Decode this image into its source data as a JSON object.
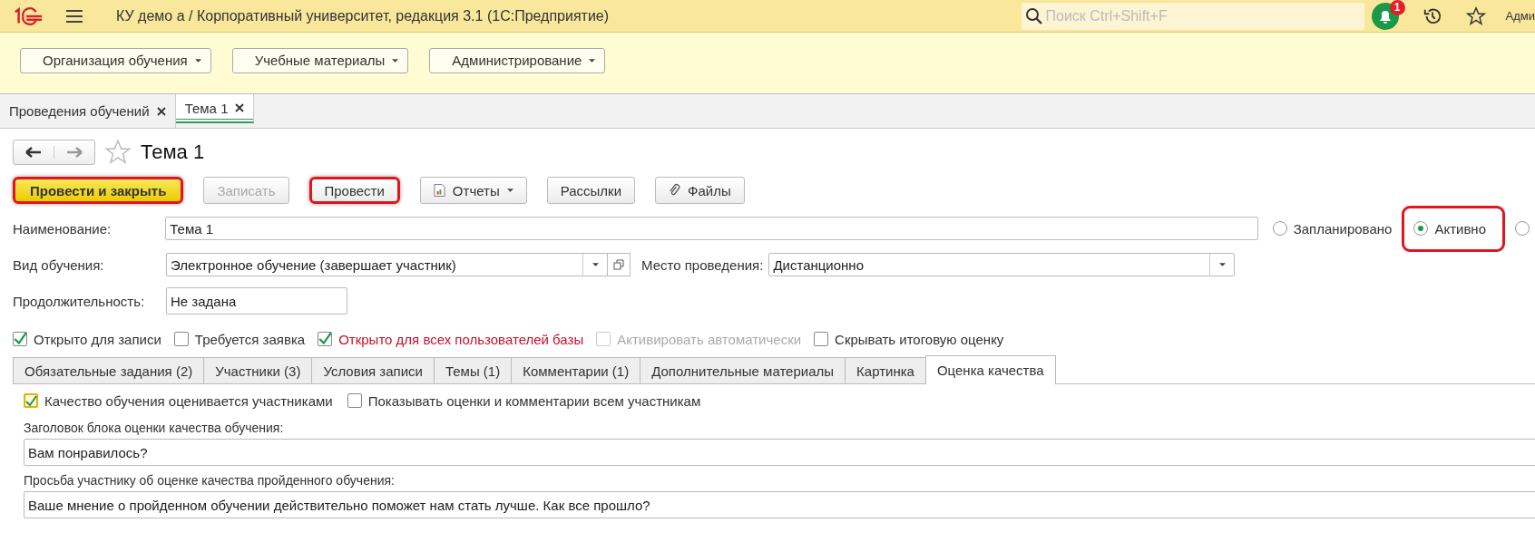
{
  "window": {
    "title": "КУ демо а / Корпоративный университет, редакция 3.1  (1С:Предприятие)",
    "search": {
      "placeholder": "Поиск Ctrl+Shift+F"
    },
    "notifications": "1",
    "user": "Адми"
  },
  "sections": [
    "Организация обучения",
    "Учебные материалы",
    "Администрирование"
  ],
  "open_tabs": [
    {
      "label": "Проведения обучений",
      "selected": false
    },
    {
      "label": "Тема 1",
      "selected": true
    }
  ],
  "form": {
    "title": "Тема 1",
    "commands": [
      {
        "label": "Провести и закрыть",
        "kind": "primary",
        "disabled": false,
        "highlighted": true
      },
      {
        "label": "Записать",
        "kind": "plain",
        "disabled": true,
        "highlighted": false
      },
      {
        "label": "Провести",
        "kind": "plain",
        "disabled": false,
        "highlighted": true
      },
      {
        "label": "Отчеты",
        "kind": "report",
        "disabled": false,
        "highlighted": false
      },
      {
        "label": "Рассылки",
        "kind": "plain",
        "disabled": false,
        "highlighted": false
      },
      {
        "label": "Файлы",
        "kind": "clip",
        "disabled": false,
        "highlighted": false
      }
    ],
    "name": {
      "label": "Наименование:",
      "value": "Тема 1"
    },
    "status": [
      {
        "label": "Запланировано",
        "selected": false,
        "highlighted": false
      },
      {
        "label": "Активно",
        "selected": true,
        "highlighted": true
      },
      {
        "selected": false,
        "highlighted": false
      }
    ],
    "kind": {
      "label": "Вид обучения:",
      "value": "Электронное обучение (завершает участник)"
    },
    "place": {
      "label": "Место проведения:",
      "value": "Дистанционно"
    },
    "duration": {
      "label": "Продолжительность:",
      "value": "Не задана"
    },
    "flags": [
      {
        "label": "Открыто для записи",
        "checked": true,
        "disabled": false,
        "alert": false
      },
      {
        "label": "Требуется заявка",
        "checked": false,
        "disabled": false,
        "alert": false
      },
      {
        "label": "Открыто для всех пользователей базы",
        "checked": true,
        "disabled": false,
        "alert": true
      },
      {
        "label": "Активировать автоматически",
        "checked": false,
        "disabled": true,
        "alert": false
      },
      {
        "label": "Скрывать итоговую оценку",
        "checked": false,
        "disabled": false,
        "alert": false
      }
    ],
    "tabs": [
      {
        "label": "Обязательные задания (2)",
        "selected": false
      },
      {
        "label": "Участники (3)",
        "selected": false
      },
      {
        "label": "Условия записи",
        "selected": false
      },
      {
        "label": "Темы (1)",
        "selected": false
      },
      {
        "label": "Комментарии (1)",
        "selected": false
      },
      {
        "label": "Дополнительные материалы",
        "selected": false
      },
      {
        "label": "Картинка",
        "selected": false
      },
      {
        "label": "Оценка качества",
        "selected": true
      }
    ],
    "quality": {
      "options": [
        {
          "label": "Качество обучения оценивается участниками",
          "checked": true,
          "focused": true
        },
        {
          "label": "Показывать оценки и комментарии всем участникам",
          "checked": false,
          "focused": false
        }
      ],
      "fields": [
        {
          "label": "Заголовок блока оценки качества обучения:",
          "value": "Вам понравилось?"
        },
        {
          "label": "Просьба участнику об оценке качества пройденного обучения:",
          "value": "Ваше мнение о пройденном обучении действительно поможет нам стать лучше. Как все прошло?"
        }
      ]
    }
  }
}
